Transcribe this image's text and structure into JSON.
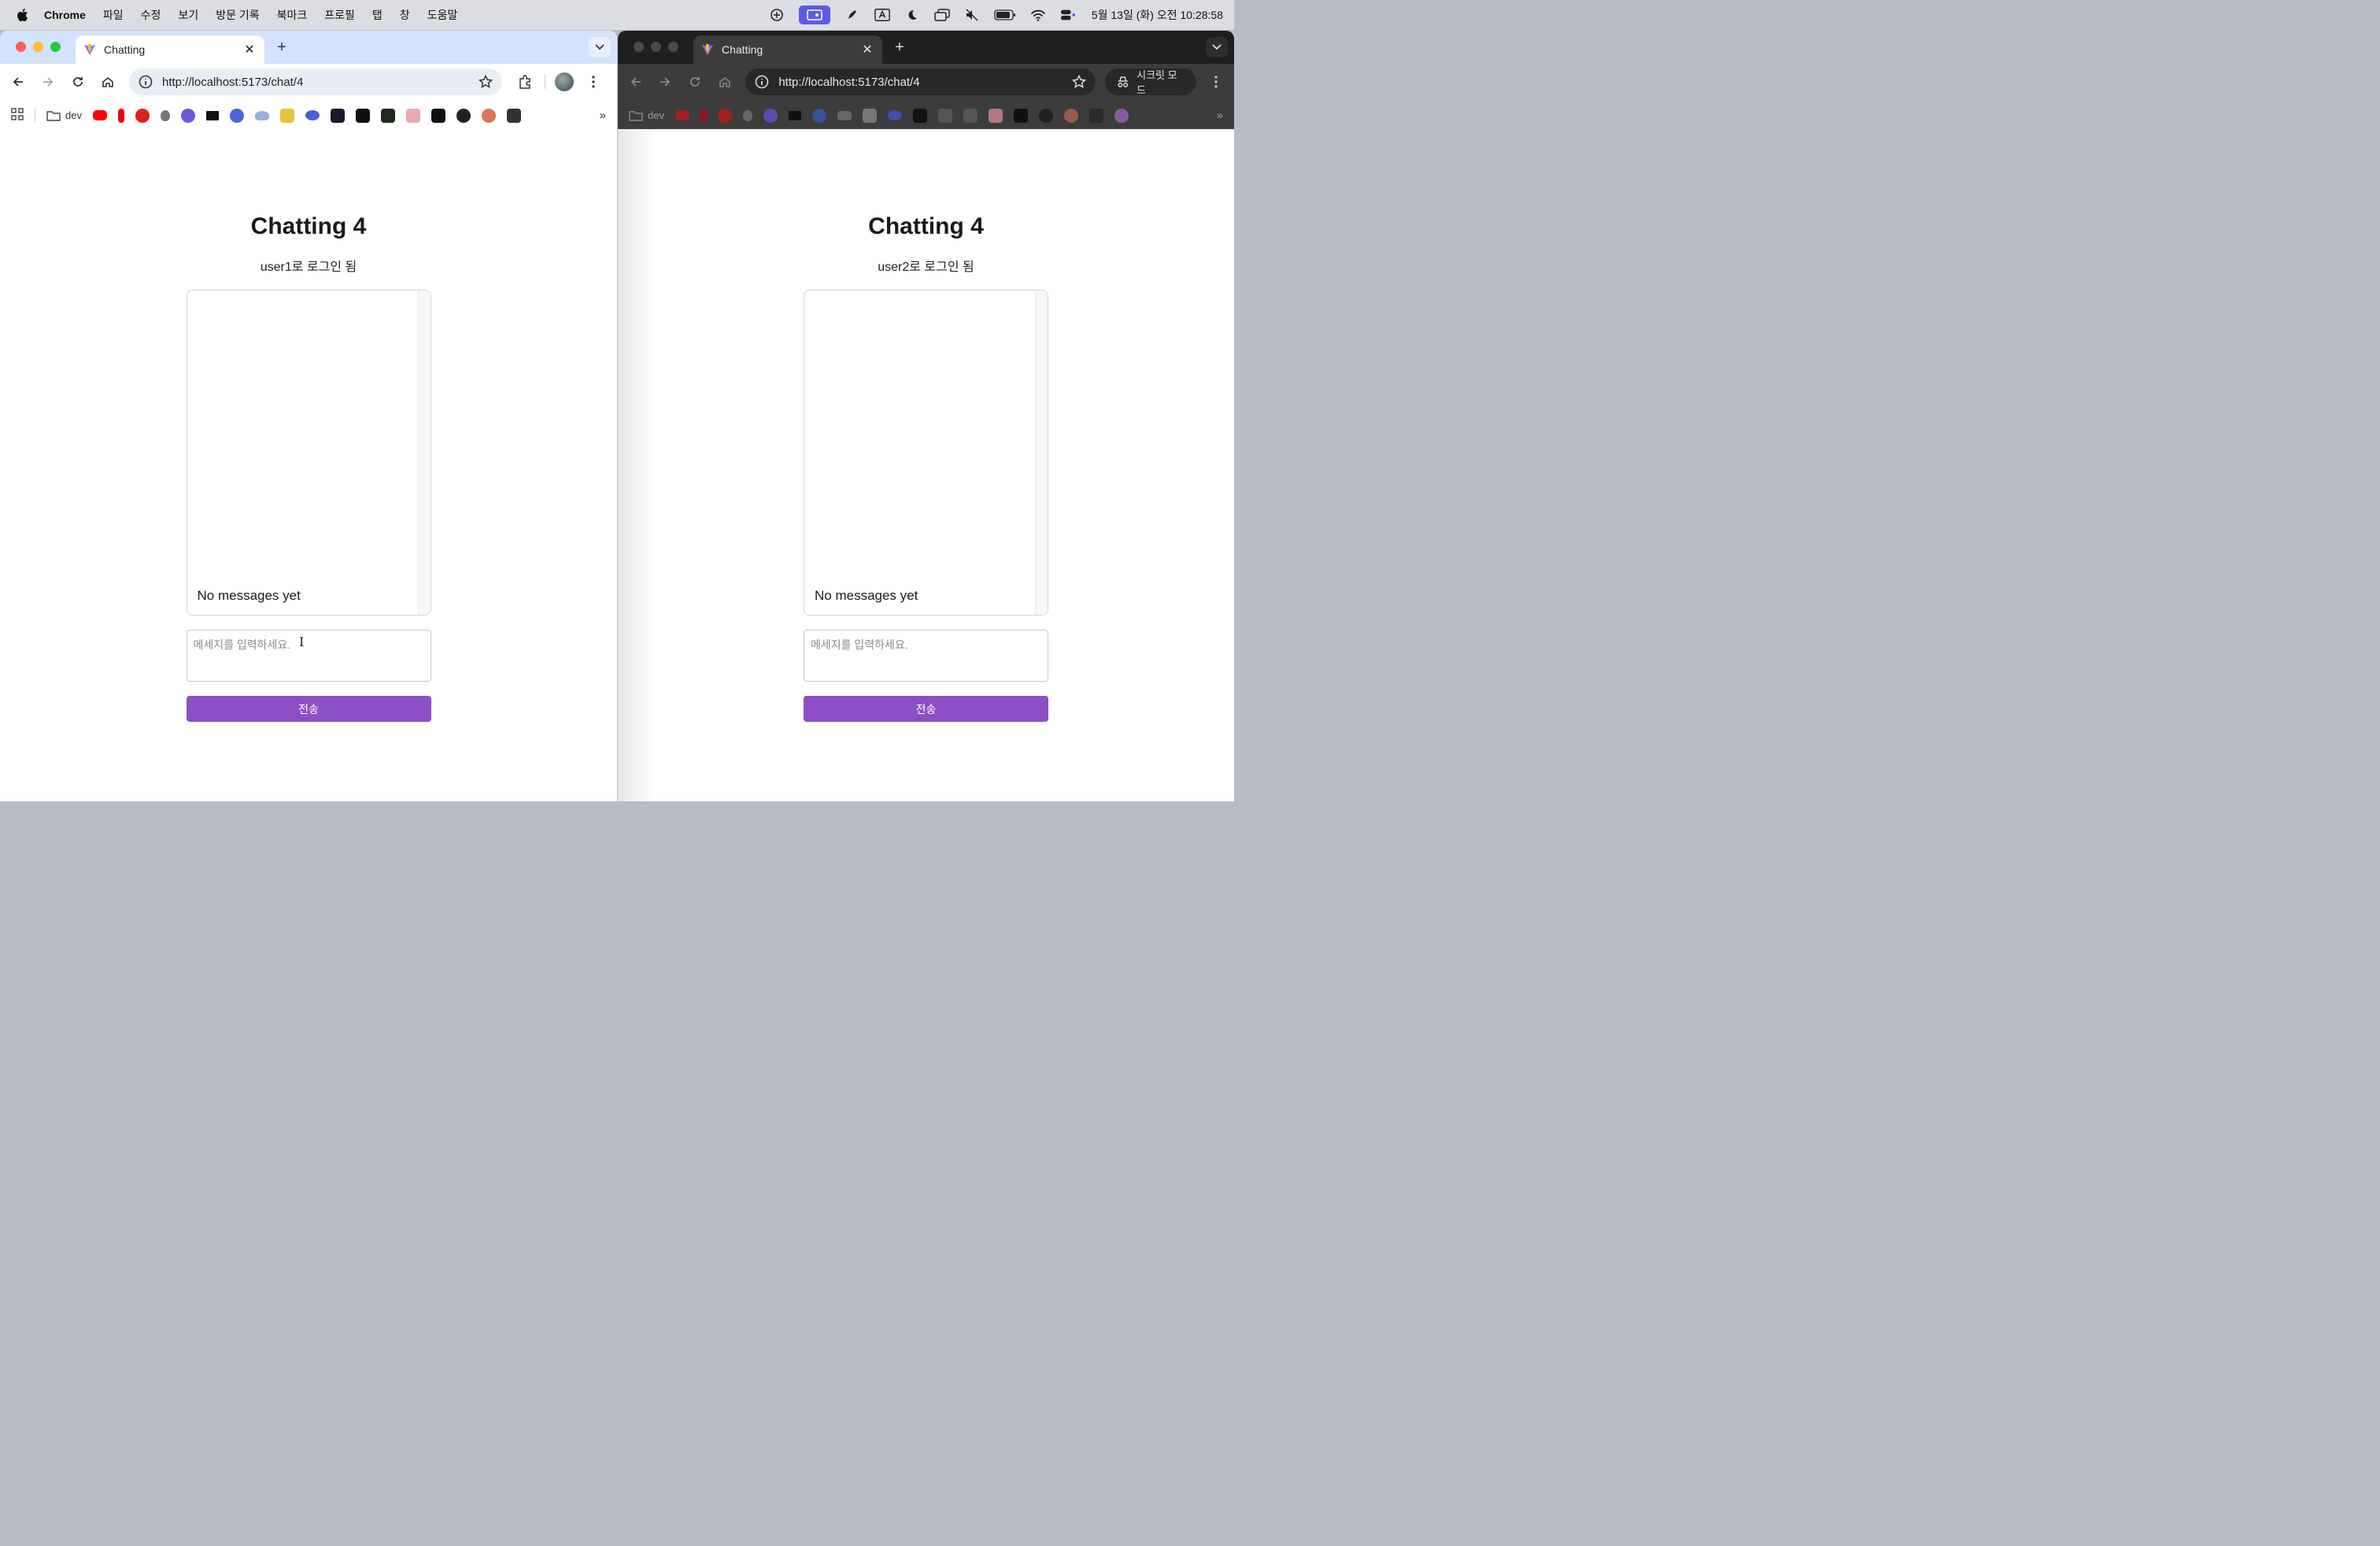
{
  "menubar": {
    "app_name": "Chrome",
    "items": [
      "파일",
      "수정",
      "보기",
      "방문 기록",
      "북마크",
      "프로필",
      "탭",
      "창",
      "도움말"
    ],
    "clock": "5월 13일 (화) 오전 10:28:58"
  },
  "left": {
    "tab_title": "Chatting",
    "url": "http://localhost:5173/chat/4",
    "bookmark_folder": "dev",
    "page": {
      "title": "Chatting 4",
      "login_status": "user1로 로그인 됨",
      "empty_message": "No messages yet",
      "input_placeholder": "메세지를 입력하세요.",
      "input_value": "",
      "send_label": "전송"
    }
  },
  "right": {
    "tab_title": "Chatting",
    "url": "http://localhost:5173/chat/4",
    "incognito_label": "시크릿 모드",
    "bookmark_folder": "dev",
    "page": {
      "title": "Chatting 4",
      "login_status": "user2로 로그인 됨",
      "empty_message": "No messages yet",
      "input_placeholder": "메세지를 입력하세요.",
      "input_value": "",
      "send_label": "전송"
    }
  },
  "colors": {
    "accent": "#8e4ec6",
    "tabstrip_light": "#d3e3fd",
    "tabstrip_dark": "#1f1f1f"
  }
}
